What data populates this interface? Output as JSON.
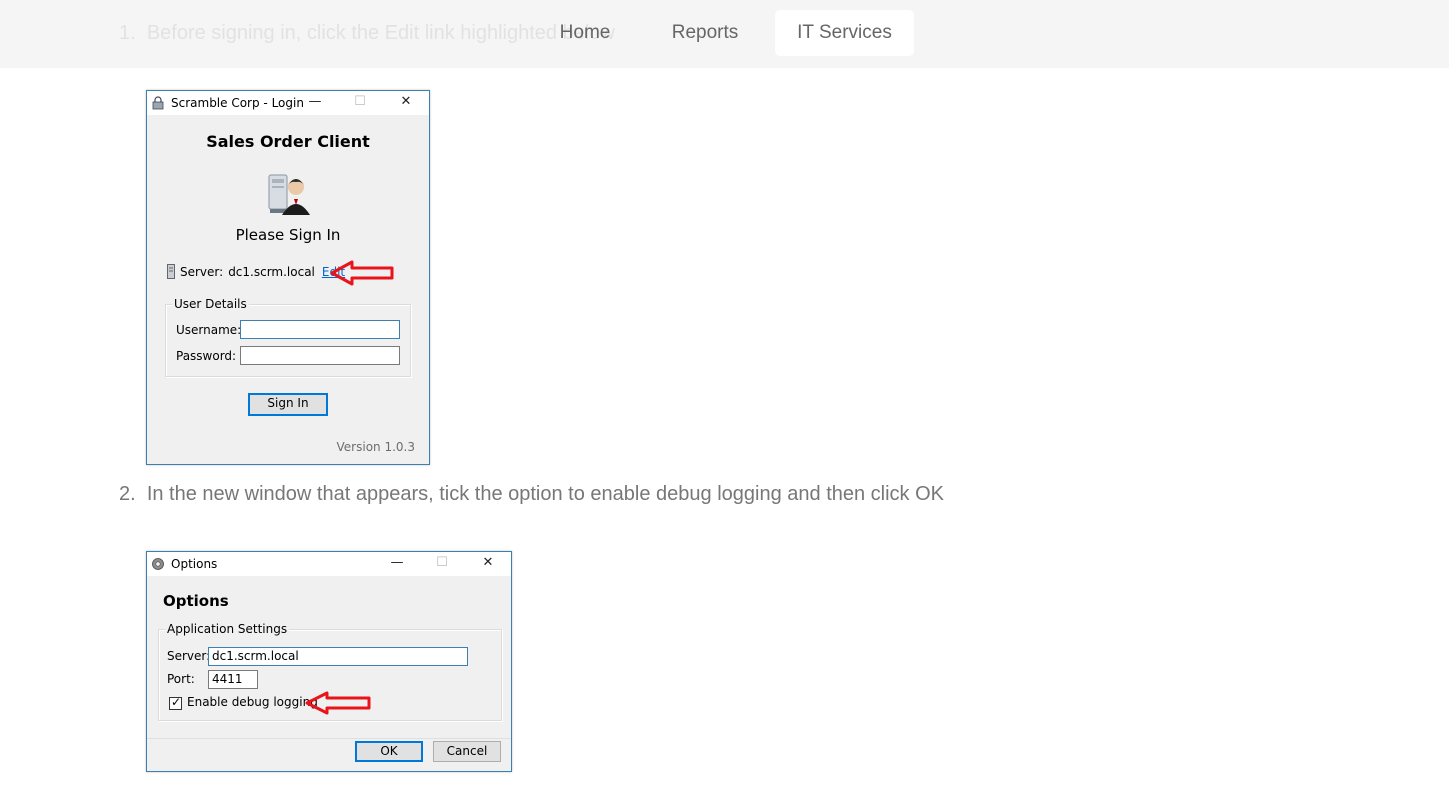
{
  "nav": {
    "items": [
      "Home",
      "Reports",
      "IT Services"
    ]
  },
  "steps": [
    {
      "number": "1.",
      "text": "Before signing in, click the Edit link highlighted below"
    },
    {
      "number": "2.",
      "text": "In the new window that appears, tick the option to enable debug logging and then click OK"
    }
  ],
  "login_window": {
    "title": "Scramble Corp - Login",
    "app_title": "Sales Order Client",
    "prompt": "Please Sign In",
    "server_label": "Server:",
    "server_value": "dc1.scrm.local",
    "edit_link": "Edit",
    "group_title": "User Details",
    "username_label": "Username:",
    "password_label": "Password:",
    "username_value": "",
    "password_value": "",
    "sign_in_button": "Sign In",
    "version": "Version 1.0.3",
    "minimize": "—",
    "maximize": "☐",
    "close": "✕"
  },
  "options_window": {
    "title": "Options",
    "heading": "Options",
    "group_title": "Application Settings",
    "server_label": "Server:",
    "server_value": "dc1.scrm.local",
    "port_label": "Port:",
    "port_value": "4411",
    "debug_label": "Enable debug logging",
    "debug_checked": true,
    "ok_button": "OK",
    "cancel_button": "Cancel",
    "minimize": "—",
    "maximize": "☐",
    "close": "✕"
  },
  "colors": {
    "annotation_arrow": "#e8141a",
    "link": "#0066cc",
    "window_border": "#3c7fb1"
  }
}
